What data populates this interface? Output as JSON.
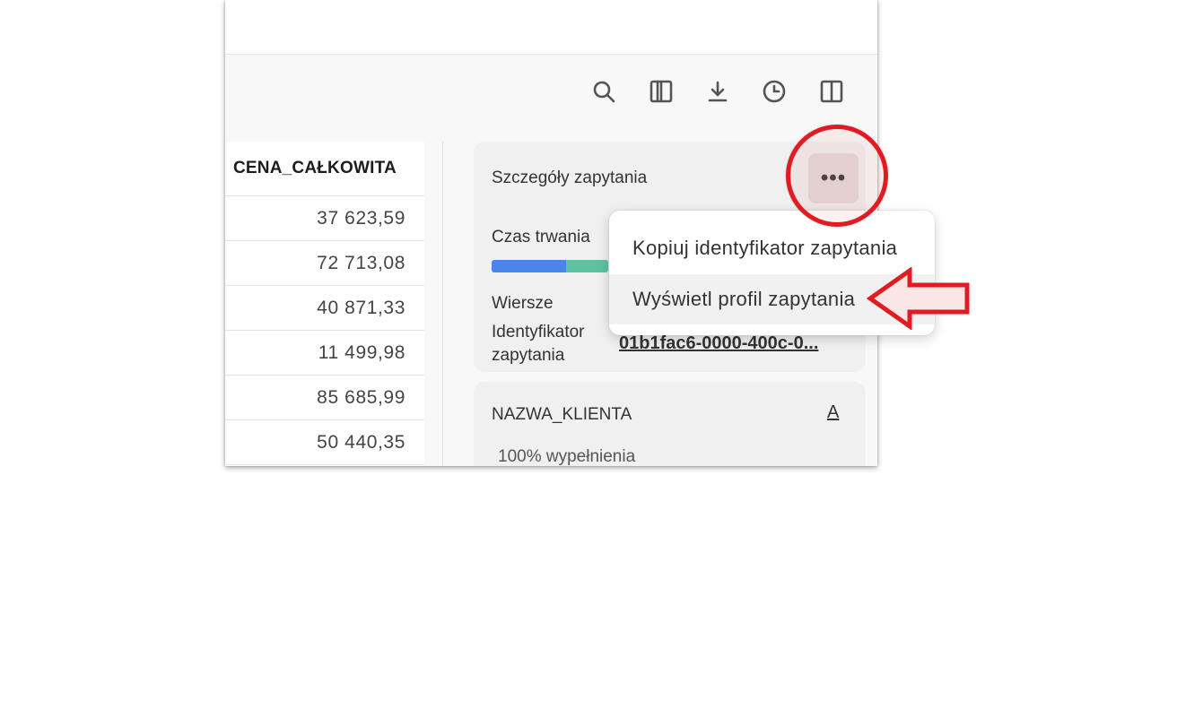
{
  "toolbar": {
    "icons": [
      "search-icon",
      "columns-icon",
      "download-icon",
      "history-icon",
      "sidebar-toggle-icon"
    ]
  },
  "results": {
    "column_header": "CENA_CAŁKOWITA",
    "rows": [
      "37 623,59",
      "72 713,08",
      "40 871,33",
      "11 499,98",
      "85 685,99",
      "50 440,35"
    ]
  },
  "details": {
    "title": "Szczegóły zapytania",
    "more_button_label": "•••",
    "duration_label": "Czas trwania",
    "rows_label": "Wiersze",
    "query_id_label_line1": "Identyfikator",
    "query_id_label_line2": "zapytania",
    "query_id_value": "01b1fac6-0000-400c-0..."
  },
  "column_card": {
    "name": "NAZWA_KLIENTA",
    "type_icon_label": "A",
    "fill_text": "100% wypełnienia"
  },
  "menu": {
    "items": [
      {
        "label": "Kopiuj identyfikator zapytania"
      },
      {
        "label": "Wyświetl profil zapytania"
      }
    ]
  },
  "colors": {
    "annotation_red": "#e21b23",
    "bar_blue": "#4a86e8",
    "bar_green": "#5dc2a0"
  }
}
